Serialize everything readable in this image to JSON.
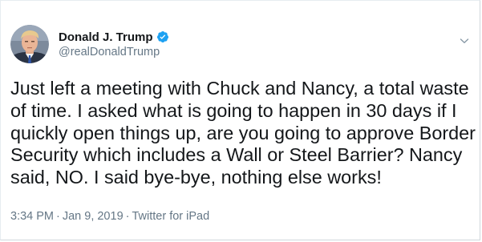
{
  "author": {
    "display_name": "Donald J. Trump",
    "handle": "@realDonaldTrump",
    "verified": true
  },
  "tweet": {
    "lines": [
      "Just left a meeting with Chuck and Nancy, a total waste",
      "of time. I asked what is going to happen in 30 days if I",
      "quickly open things up, are you going to approve Border",
      "Security which includes a Wall or Steel Barrier? Nancy",
      "said, NO. I said bye-bye, nothing else works!"
    ]
  },
  "meta": {
    "time": "3:34 PM",
    "separator": "·",
    "date": "Jan 9, 2019",
    "source": "Twitter for iPad"
  },
  "colors": {
    "text": "#14171a",
    "secondary": "#657786",
    "verified_badge": "#1da1f2"
  },
  "icons": {
    "verified": "verified-badge-icon",
    "caret": "chevron-down-icon"
  }
}
